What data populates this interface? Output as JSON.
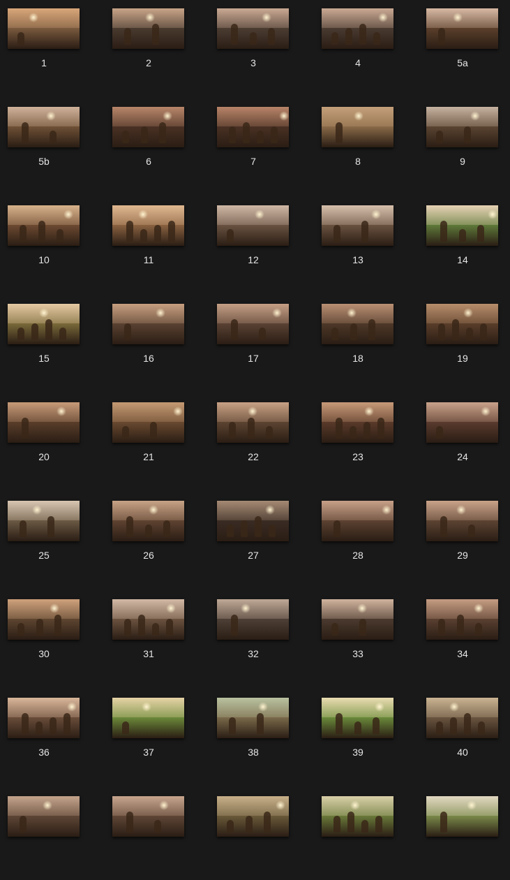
{
  "labels": [
    "1",
    "2",
    "3",
    "4",
    "5a",
    "5b",
    "6",
    "7",
    "8",
    "9",
    "10",
    "11",
    "12",
    "13",
    "14",
    "15",
    "16",
    "17",
    "18",
    "19",
    "20",
    "21",
    "22",
    "23",
    "24",
    "25",
    "26",
    "27",
    "28",
    "29",
    "30",
    "31",
    "32",
    "33",
    "34",
    "36",
    "37",
    "38",
    "39",
    "40",
    "",
    "",
    "",
    "",
    ""
  ],
  "colors": {
    "background": "#191919",
    "label": "#e6e6e6"
  }
}
